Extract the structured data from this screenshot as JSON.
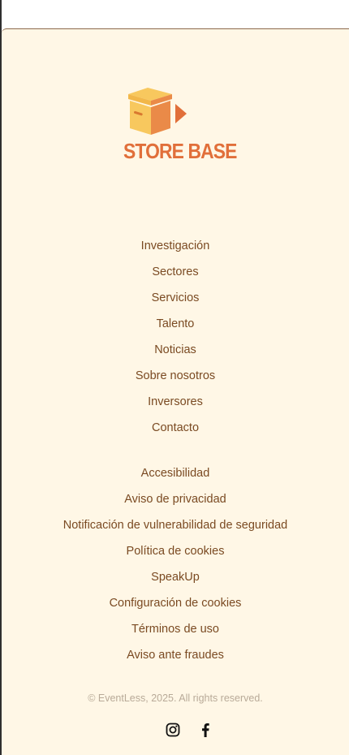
{
  "brand": {
    "name": "STORE BASE",
    "colors": {
      "accent": "#e16f3a",
      "box_light": "#f8c85e",
      "box_dark": "#ea8a48",
      "background": "#fff7e6",
      "link": "#7a4a22",
      "muted": "#b8aa98"
    }
  },
  "footer": {
    "primary_links": [
      {
        "label": "Investigación"
      },
      {
        "label": "Sectores"
      },
      {
        "label": "Servicios"
      },
      {
        "label": "Talento"
      },
      {
        "label": "Noticias"
      },
      {
        "label": "Sobre nosotros"
      },
      {
        "label": "Inversores"
      },
      {
        "label": "Contacto"
      }
    ],
    "legal_links": [
      {
        "label": "Accesibilidad"
      },
      {
        "label": "Aviso de privacidad"
      },
      {
        "label": "Notificación de vulnerabilidad de seguridad"
      },
      {
        "label": "Política de cookies"
      },
      {
        "label": "SpeakUp"
      },
      {
        "label": "Configuración de cookies"
      },
      {
        "label": "Términos de uso"
      },
      {
        "label": "Aviso ante fraudes"
      }
    ],
    "copyright": "© EventLess, 2025. All rights reserved.",
    "social": [
      {
        "icon": "instagram-icon"
      },
      {
        "icon": "facebook-icon"
      }
    ]
  }
}
